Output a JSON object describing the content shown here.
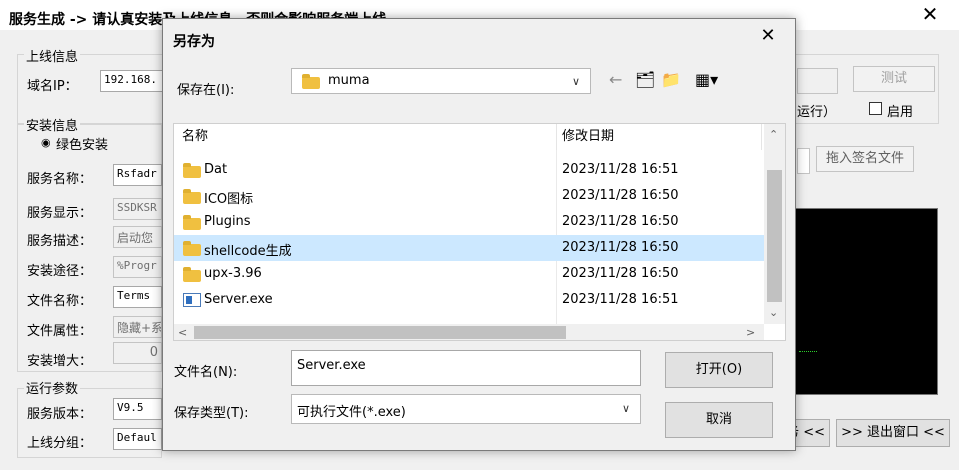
{
  "bg_window": {
    "title": "服务生成 -> 请认真安装及上线信息，否则会影响服务端上线",
    "close_icon": "close-icon",
    "online_group": {
      "title": "上线信息",
      "domain_label": "域名IP：",
      "domain_value": "192.168.",
      "test_button": "测试",
      "run_hint": "运行）",
      "enable_label": "启用"
    },
    "install_group": {
      "title": "安装信息",
      "green_install": "绿色安装",
      "service_name_label": "服务名称：",
      "service_name_value": "Rsfadr",
      "service_display_label": "服务显示：",
      "service_display_value": "SSDKSR",
      "service_desc_label": "服务描述：",
      "service_desc_value": "启动您",
      "install_path_label": "安装途径：",
      "install_path_value": "%Progr",
      "file_name_label": "文件名称：",
      "file_name_value": "Terms",
      "file_attr_label": "文件属性：",
      "file_attr_value": "隐藏+系",
      "install_growth_label": "安装增大：",
      "install_growth_value": "0"
    },
    "drag_sign_button": "拖入签名文件",
    "run_params": {
      "title": "运行参数",
      "service_version_label": "服务版本：",
      "service_version_value": "V9.5",
      "group_label": "上线分组：",
      "group_value": "Defaul"
    },
    "bottom_buttons": {
      "service_fragment": "务 <<",
      "exit_button": ">> 退出窗口 <<"
    }
  },
  "dialog": {
    "title": "另存为",
    "save_in_label": "保存在(I):",
    "save_in_value": "muma",
    "columns": {
      "name": "名称",
      "date": "修改日期"
    },
    "files": [
      {
        "name": "Dat",
        "date": "2023/11/28 16:51",
        "type": "folder"
      },
      {
        "name": "ICO图标",
        "date": "2023/11/28 16:50",
        "type": "folder"
      },
      {
        "name": "Plugins",
        "date": "2023/11/28 16:50",
        "type": "folder"
      },
      {
        "name": "shellcode生成",
        "date": "2023/11/28 16:50",
        "type": "folder",
        "selected": true
      },
      {
        "name": "upx-3.96",
        "date": "2023/11/28 16:50",
        "type": "folder"
      },
      {
        "name": "Server.exe",
        "date": "2023/11/28 16:51",
        "type": "exe"
      }
    ],
    "filename_label": "文件名(N):",
    "filename_value": "Server.exe",
    "filetype_label": "保存类型(T):",
    "filetype_value": "可执行文件(*.exe)",
    "open_button": "打开(O)",
    "cancel_button": "取消"
  },
  "colors": {
    "selected_row": "#cce8ff",
    "folder": "#f0c040",
    "log_panel": "#000000"
  }
}
